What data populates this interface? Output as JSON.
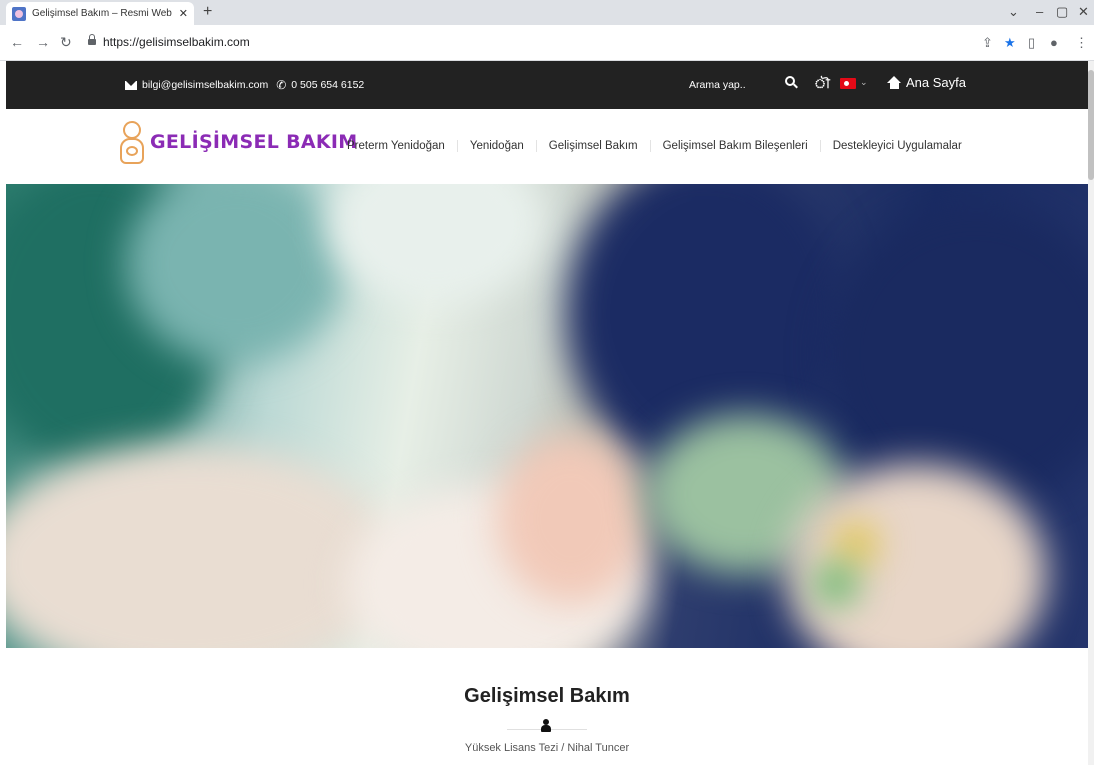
{
  "browser": {
    "tab_title": "Gelişimsel Bakım – Resmi Web Si",
    "tab_close": "✕",
    "new_tab": "+",
    "url": "https://gelisimselbakim.com",
    "window_controls": [
      "⌄",
      "–",
      "▢",
      "✕"
    ]
  },
  "topbar": {
    "email": "bilgi@gelisimselbakim.com",
    "phone": "0 505 654 6152",
    "search_label": "Arama yap..",
    "home_label": "Ana Sayfa",
    "flag_chevron": "⌄"
  },
  "header": {
    "logo_text": "GELİŞİMSEL BAKIM",
    "nav": [
      "Preterm Yenidoğan",
      "Yenidoğan",
      "Gelişimsel Bakım",
      "Gelişimsel Bakım Bileşenleri",
      "Destekleyici Uygulamalar"
    ]
  },
  "intro": {
    "title": "Gelişimsel Bakım",
    "subtitle": "Yüksek Lisans Tezi / Nihal Tuncer"
  },
  "colors": {
    "topbar_bg": "#222222",
    "logo_purple": "#8b2bb5",
    "logo_orange": "#e8a35a"
  }
}
